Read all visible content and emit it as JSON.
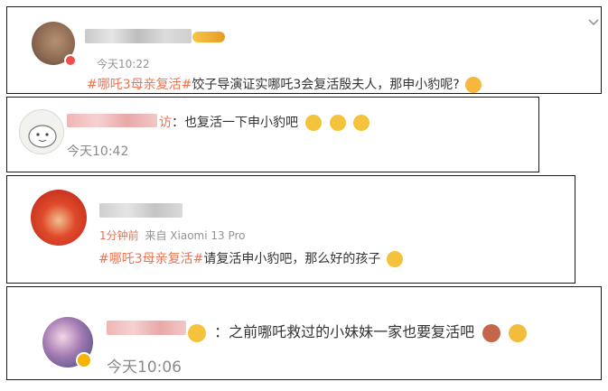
{
  "comments": [
    {
      "hashtag": "#哪吒3母亲复活#",
      "body": "饺子导演证实哪吒3会复活殷夫人，那申小豹呢?",
      "time": "今天10:22",
      "emoji": "grinning-sweat-emoji",
      "badge": "red-v-badge"
    },
    {
      "name_tail": "访",
      "body": "：也复活一下申小豹吧",
      "time": "今天10:42",
      "emoji": "crying-emoji"
    },
    {
      "time": "1分钟前",
      "source": "来自 Xiaomi 13 Pro",
      "hashtag": "#哪吒3母亲复活#",
      "body": "请复活申小豹吧，那么好的孩子",
      "emoji": "crying-emoji"
    },
    {
      "colon": "：",
      "body": "之前哪吒救过的小妹妹一家也要复活吧",
      "time": "今天10:06",
      "badge": "gold-v-badge"
    }
  ],
  "icons": {
    "collapse": "chevron-down-icon"
  },
  "colors": {
    "hashtag": "#eb7350",
    "time": "#939393",
    "text": "#333333",
    "border": "#1a1a1a"
  }
}
